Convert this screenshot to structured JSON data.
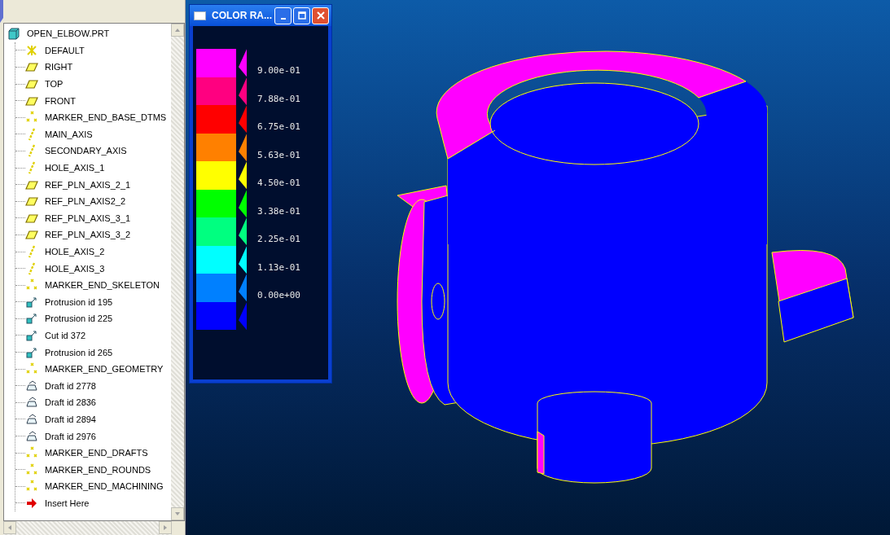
{
  "model_tree": {
    "root": {
      "label": "OPEN_ELBOW.PRT",
      "kind": "part"
    },
    "items": [
      {
        "label": "DEFAULT",
        "kind": "csys"
      },
      {
        "label": "RIGHT",
        "kind": "plane"
      },
      {
        "label": "TOP",
        "kind": "plane"
      },
      {
        "label": "FRONT",
        "kind": "plane"
      },
      {
        "label": "MARKER_END_BASE_DTMS",
        "kind": "marker"
      },
      {
        "label": "MAIN_AXIS",
        "kind": "axis"
      },
      {
        "label": "SECONDARY_AXIS",
        "kind": "axis"
      },
      {
        "label": "HOLE_AXIS_1",
        "kind": "axis"
      },
      {
        "label": "REF_PLN_AXIS_2_1",
        "kind": "plane"
      },
      {
        "label": "REF_PLN_AXIS2_2",
        "kind": "plane"
      },
      {
        "label": "REF_PLN_AXIS_3_1",
        "kind": "plane"
      },
      {
        "label": "REF_PLN_AXIS_3_2",
        "kind": "plane"
      },
      {
        "label": "HOLE_AXIS_2",
        "kind": "axis"
      },
      {
        "label": "HOLE_AXIS_3",
        "kind": "axis"
      },
      {
        "label": "MARKER_END_SKELETON",
        "kind": "marker"
      },
      {
        "label": "Protrusion id 195",
        "kind": "feature"
      },
      {
        "label": "Protrusion id 225",
        "kind": "feature"
      },
      {
        "label": "Cut id 372",
        "kind": "feature"
      },
      {
        "label": "Protrusion id 265",
        "kind": "feature"
      },
      {
        "label": "MARKER_END_GEOMETRY",
        "kind": "marker"
      },
      {
        "label": "Draft id 2778",
        "kind": "draft"
      },
      {
        "label": "Draft id 2836",
        "kind": "draft"
      },
      {
        "label": "Draft id 2894",
        "kind": "draft"
      },
      {
        "label": "Draft id 2976",
        "kind": "draft"
      },
      {
        "label": "MARKER_END_DRAFTS",
        "kind": "marker"
      },
      {
        "label": "MARKER_END_ROUNDS",
        "kind": "marker"
      },
      {
        "label": "MARKER_END_MACHINING",
        "kind": "marker"
      },
      {
        "label": "Insert Here",
        "kind": "insert"
      }
    ]
  },
  "color_range": {
    "title": "COLOR RA...",
    "bands": [
      {
        "color": "#ff00ff"
      },
      {
        "color": "#ff0080"
      },
      {
        "color": "#ff0000"
      },
      {
        "color": "#ff8000"
      },
      {
        "color": "#ffff00"
      },
      {
        "color": "#00ff00"
      },
      {
        "color": "#00ff80"
      },
      {
        "color": "#00ffff"
      },
      {
        "color": "#0080ff"
      },
      {
        "color": "#0000ff"
      }
    ],
    "labels": [
      "9.00e-01",
      "7.88e-01",
      "6.75e-01",
      "5.63e-01",
      "4.50e-01",
      "3.38e-01",
      "2.25e-01",
      "1.13e-01",
      "0.00e+00"
    ]
  }
}
